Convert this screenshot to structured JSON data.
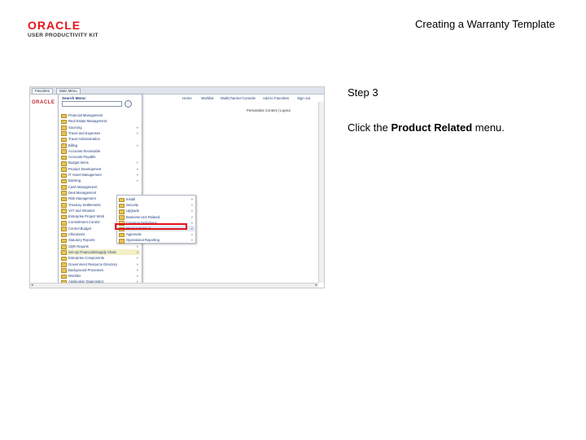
{
  "header": {
    "logo_brand": "ORACLE",
    "logo_sub": "USER PRODUCTIVITY KIT",
    "doc_title": "Creating a Warranty Template"
  },
  "screenshot": {
    "tabs": [
      "Favorites",
      "Main Menu"
    ],
    "top_links": [
      "Home",
      "Worklist",
      "MultiChannel Console",
      "Add to Favorites",
      "Sign out"
    ],
    "app_title": "ORACLE",
    "personalize_text": "Personalize Content | Layout",
    "search_label": "Search Menu:",
    "menu_items": [
      {
        "label": "Financial Management",
        "arrow": ""
      },
      {
        "label": "Real Estate Management",
        "arrow": ""
      },
      {
        "label": "Sourcing",
        "arrow": "»"
      },
      {
        "label": "Travel and Expenses",
        "arrow": "»"
      },
      {
        "label": "Travel Administration",
        "arrow": ""
      },
      {
        "label": "Billing",
        "arrow": "»"
      },
      {
        "label": "Accounts Receivable",
        "arrow": ""
      },
      {
        "label": "Accounts Payable",
        "arrow": ""
      },
      {
        "label": "Budget Items",
        "arrow": "»"
      },
      {
        "label": "Product Development",
        "arrow": "»"
      },
      {
        "label": "IT Asset Management",
        "arrow": "»"
      },
      {
        "label": "Banking",
        "arrow": "»"
      },
      {
        "label": "Cash Management",
        "arrow": ""
      },
      {
        "label": "Deal Management",
        "arrow": ""
      },
      {
        "label": "Risk Management",
        "arrow": ""
      },
      {
        "label": "Treasury Settlements",
        "arrow": "»"
      },
      {
        "label": "VAT and Intrastat",
        "arrow": "»"
      },
      {
        "label": "Enterprise Project Work",
        "arrow": "»"
      },
      {
        "label": "Commitment Control",
        "arrow": "»"
      },
      {
        "label": "Control Budget",
        "arrow": "»"
      },
      {
        "label": "Allocations",
        "arrow": "»"
      },
      {
        "label": "Statutory Reports",
        "arrow": "»"
      },
      {
        "label": "SQR Reports",
        "arrow": "»"
      },
      {
        "label": "Set Up Financials/Supply Chain",
        "arrow": "»"
      },
      {
        "label": "Enterprise Components",
        "arrow": "»"
      },
      {
        "label": "Government Resource Directory",
        "arrow": "»"
      },
      {
        "label": "Background Processes",
        "arrow": "»"
      },
      {
        "label": "Worklist",
        "arrow": "»"
      },
      {
        "label": "Application Diagnostics",
        "arrow": "»"
      }
    ],
    "submenu_items": [
      {
        "label": "Install",
        "arrow": "»"
      },
      {
        "label": "Security",
        "arrow": "»"
      },
      {
        "label": "Upgrade",
        "arrow": "»"
      },
      {
        "label": "Business Unit Related",
        "arrow": "»"
      },
      {
        "label": "Common Definitions",
        "arrow": "»"
      },
      {
        "label": "Product Related",
        "arrow": "»"
      },
      {
        "label": "Approvals",
        "arrow": "»"
      },
      {
        "label": "Operational Reporting",
        "arrow": "»"
      }
    ]
  },
  "instructions": {
    "step": "Step 3",
    "text_before": "Click the ",
    "text_bold": "Product Related",
    "text_after": " menu."
  }
}
